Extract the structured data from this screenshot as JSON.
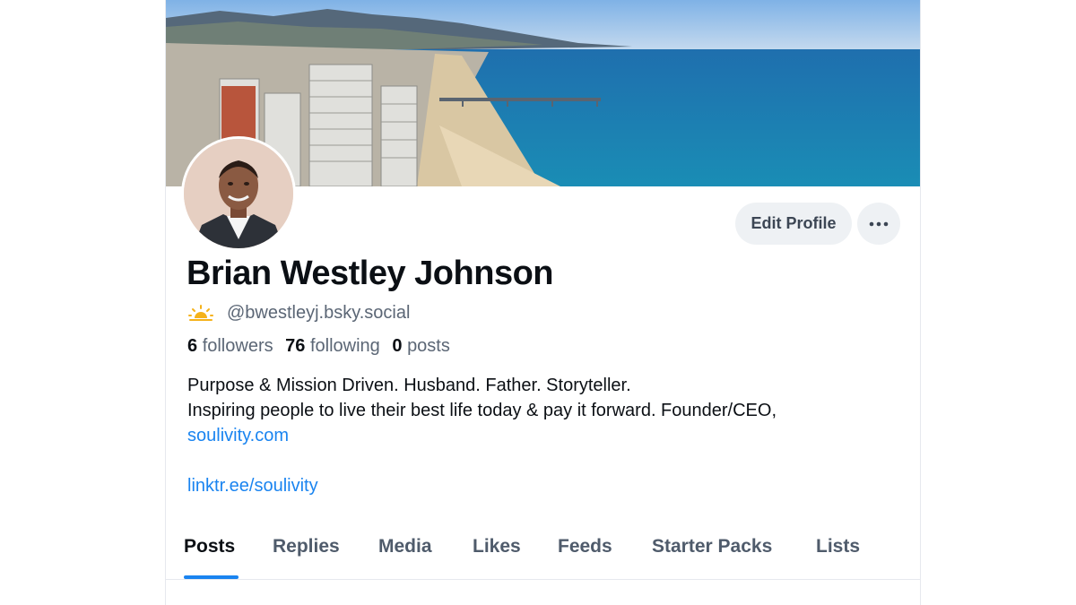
{
  "profile": {
    "display_name": "Brian Westley Johnson",
    "handle": "@bwestleyj.bsky.social",
    "handle_icon": "sunrise-icon",
    "stats": {
      "followers_count": "6",
      "followers_label": "followers",
      "following_count": "76",
      "following_label": "following",
      "posts_count": "0",
      "posts_label": "posts"
    },
    "bio": {
      "line1": "Purpose & Mission Driven. Husband. Father. Storyteller.",
      "line2": "Inspiring people to live their best life today & pay it forward. Founder/CEO,",
      "link1": "soulivity.com",
      "link2": "linktr.ee/soulivity"
    }
  },
  "actions": {
    "edit_profile_label": "Edit Profile",
    "more_icon": "ellipsis-icon"
  },
  "tabs": [
    {
      "label": "Posts",
      "active": true
    },
    {
      "label": "Replies",
      "active": false
    },
    {
      "label": "Media",
      "active": false
    },
    {
      "label": "Likes",
      "active": false
    },
    {
      "label": "Feeds",
      "active": false
    },
    {
      "label": "Starter Packs",
      "active": false
    },
    {
      "label": "Lists",
      "active": false
    }
  ],
  "colors": {
    "accent": "#1a84f0",
    "button_bg": "#eef1f4",
    "text_primary": "#0b0f14",
    "text_secondary": "#5b6675"
  }
}
